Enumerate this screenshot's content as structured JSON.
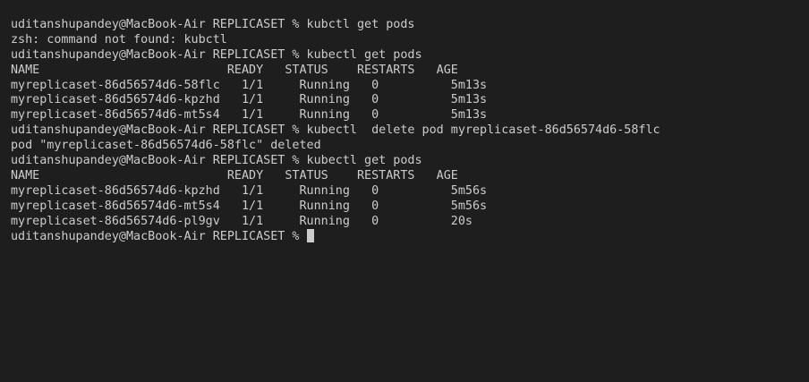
{
  "terminal": {
    "lines": [
      "uditanshupandey@MacBook-Air REPLICASET % kubctl get pods",
      "zsh: command not found: kubctl",
      "uditanshupandey@MacBook-Air REPLICASET % kubectl get pods",
      "NAME                          READY   STATUS    RESTARTS   AGE",
      "myreplicaset-86d56574d6-58flc   1/1     Running   0          5m13s",
      "myreplicaset-86d56574d6-kpzhd   1/1     Running   0          5m13s",
      "myreplicaset-86d56574d6-mt5s4   1/1     Running   0          5m13s",
      "uditanshupandey@MacBook-Air REPLICASET % kubectl  delete pod myreplicaset-86d56574d6-58flc",
      "pod \"myreplicaset-86d56574d6-58flc\" deleted",
      "uditanshupandey@MacBook-Air REPLICASET % kubectl get pods",
      "NAME                          READY   STATUS    RESTARTS   AGE",
      "myreplicaset-86d56574d6-kpzhd   1/1     Running   0          5m56s",
      "myreplicaset-86d56574d6-mt5s4   1/1     Running   0          5m56s",
      "myreplicaset-86d56574d6-pl9gv   1/1     Running   0          20s"
    ],
    "prompt": "uditanshupandey@MacBook-Air REPLICASET % "
  }
}
